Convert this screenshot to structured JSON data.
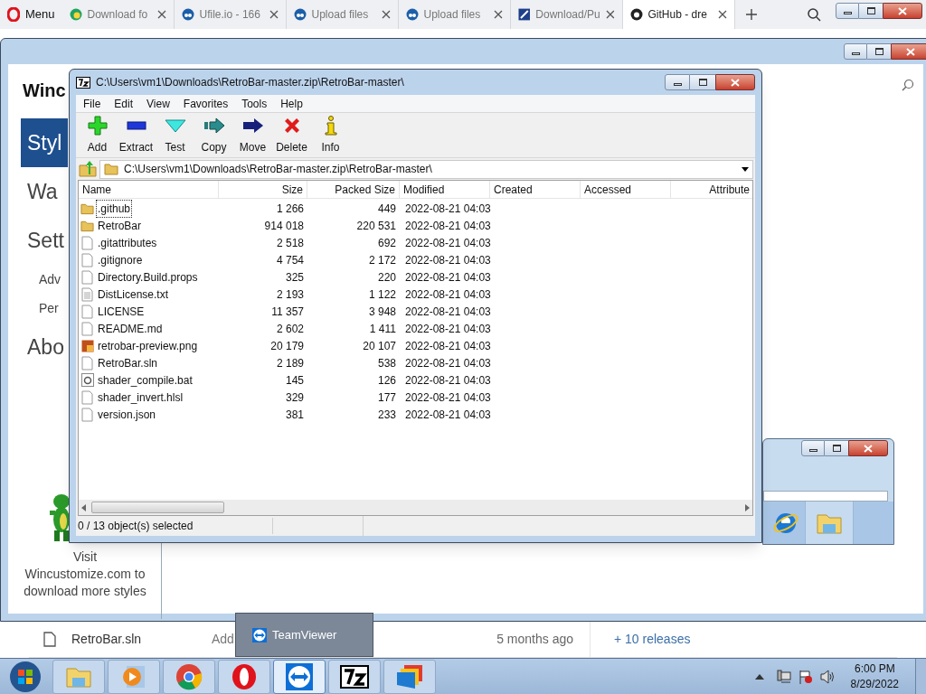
{
  "browser": {
    "menu_label": "Menu",
    "tabs": [
      {
        "label": "Download fo",
        "kind": "edge",
        "selected": false
      },
      {
        "label": "Ufile.io - 166",
        "kind": "cloud",
        "selected": false
      },
      {
        "label": "Upload files",
        "kind": "cloud",
        "selected": false
      },
      {
        "label": "Upload files",
        "kind": "cloud",
        "selected": false
      },
      {
        "label": "Download/Pu",
        "kind": "square",
        "selected": false
      },
      {
        "label": "GitHub - dre",
        "kind": "github",
        "selected": true
      }
    ]
  },
  "back_window": {
    "heading": "Winc",
    "nav": [
      {
        "label": "Styl",
        "kind": "large",
        "selected": true
      },
      {
        "label": "Wa",
        "kind": "large",
        "selected": false
      },
      {
        "label": "Sett",
        "kind": "large",
        "selected": false
      },
      {
        "label": "Adv",
        "kind": "small",
        "selected": false
      },
      {
        "label": "Per",
        "kind": "small",
        "selected": false
      },
      {
        "label": "Abo",
        "kind": "large",
        "selected": false
      }
    ],
    "promo_lines": [
      "Visit",
      "Wincustomize.com to",
      "download more styles"
    ]
  },
  "github_row": {
    "file": "RetroBar.sln",
    "message": "Add",
    "age": "5 months ago",
    "releases": "+ 10 releases"
  },
  "sevenzip": {
    "title": "C:\\Users\\vm1\\Downloads\\RetroBar-master.zip\\RetroBar-master\\",
    "menu": [
      "File",
      "Edit",
      "View",
      "Favorites",
      "Tools",
      "Help"
    ],
    "toolbar": [
      {
        "label": "Add",
        "kind": "add"
      },
      {
        "label": "Extract",
        "kind": "extract"
      },
      {
        "label": "Test",
        "kind": "test"
      },
      {
        "label": "Copy",
        "kind": "copy"
      },
      {
        "label": "Move",
        "kind": "move"
      },
      {
        "label": "Delete",
        "kind": "delete"
      },
      {
        "label": "Info",
        "kind": "info"
      }
    ],
    "address": "C:\\Users\\vm1\\Downloads\\RetroBar-master.zip\\RetroBar-master\\",
    "columns": [
      "Name",
      "Size",
      "Packed Size",
      "Modified",
      "Created",
      "Accessed",
      "Attribute"
    ],
    "rows": [
      {
        "name": ".github",
        "kind": "folder",
        "size": "1 266",
        "packed": "449",
        "modified": "2022-08-21 04:03",
        "focused": true
      },
      {
        "name": "RetroBar",
        "kind": "folder",
        "size": "914 018",
        "packed": "220 531",
        "modified": "2022-08-21 04:03",
        "focused": false
      },
      {
        "name": ".gitattributes",
        "kind": "file",
        "size": "2 518",
        "packed": "692",
        "modified": "2022-08-21 04:03",
        "focused": false
      },
      {
        "name": ".gitignore",
        "kind": "file",
        "size": "4 754",
        "packed": "2 172",
        "modified": "2022-08-21 04:03",
        "focused": false
      },
      {
        "name": "Directory.Build.props",
        "kind": "file",
        "size": "325",
        "packed": "220",
        "modified": "2022-08-21 04:03",
        "focused": false
      },
      {
        "name": "DistLicense.txt",
        "kind": "text",
        "size": "2 193",
        "packed": "1 122",
        "modified": "2022-08-21 04:03",
        "focused": false
      },
      {
        "name": "LICENSE",
        "kind": "file",
        "size": "11 357",
        "packed": "3 948",
        "modified": "2022-08-21 04:03",
        "focused": false
      },
      {
        "name": "README.md",
        "kind": "file",
        "size": "2 602",
        "packed": "1 411",
        "modified": "2022-08-21 04:03",
        "focused": false
      },
      {
        "name": "retrobar-preview.png",
        "kind": "image",
        "size": "20 179",
        "packed": "20 107",
        "modified": "2022-08-21 04:03",
        "focused": false
      },
      {
        "name": "RetroBar.sln",
        "kind": "file",
        "size": "2 189",
        "packed": "538",
        "modified": "2022-08-21 04:03",
        "focused": false
      },
      {
        "name": "shader_compile.bat",
        "kind": "script",
        "size": "145",
        "packed": "126",
        "modified": "2022-08-21 04:03",
        "focused": false
      },
      {
        "name": "shader_invert.hlsl",
        "kind": "file",
        "size": "329",
        "packed": "177",
        "modified": "2022-08-21 04:03",
        "focused": false
      },
      {
        "name": "version.json",
        "kind": "file",
        "size": "381",
        "packed": "233",
        "modified": "2022-08-21 04:03",
        "focused": false
      }
    ],
    "status": "0 / 13 object(s) selected"
  },
  "popup": {
    "label": "TeamViewer"
  },
  "taskbar": {
    "apps": [
      {
        "kind": "explorer",
        "active": false
      },
      {
        "kind": "media",
        "active": false
      },
      {
        "kind": "chrome",
        "active": false
      },
      {
        "kind": "opera",
        "active": false
      },
      {
        "kind": "teamviewer",
        "active": true
      },
      {
        "kind": "sevenzip",
        "active": false
      },
      {
        "kind": "folders",
        "active": false
      }
    ],
    "time": "6:00 PM",
    "date": "8/29/2022"
  }
}
